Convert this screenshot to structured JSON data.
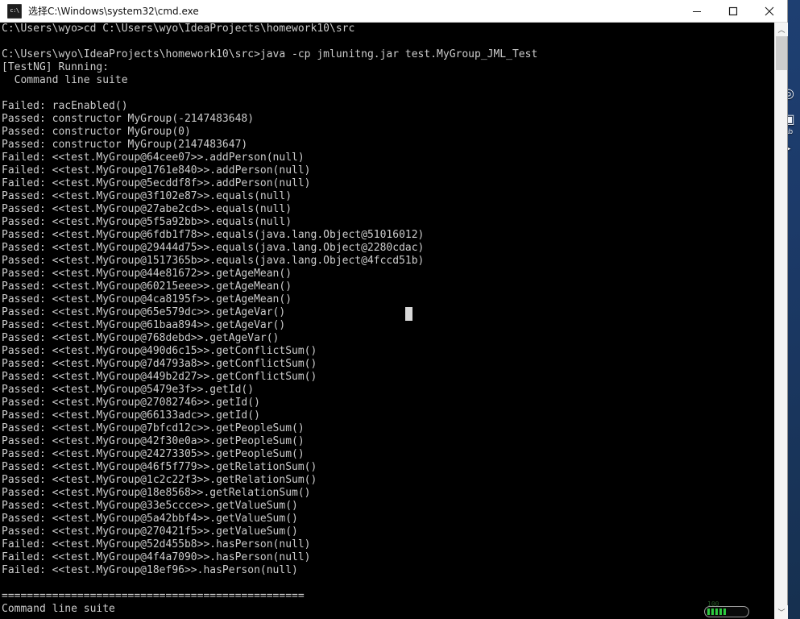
{
  "window": {
    "title": "选择C:\\Windows\\system32\\cmd.exe",
    "icon": "cmd-icon",
    "icon_glyph": "c:\\",
    "minimize_label": "Minimize",
    "maximize_label": "Maximize",
    "close_label": "Close"
  },
  "desktop": {
    "icons": [
      {
        "name": "desktop-icon-edge",
        "glyph": "◎",
        "label": ""
      },
      {
        "name": "desktop-icon-folder",
        "glyph": "▣",
        "label": "ab"
      },
      {
        "name": "desktop-icon-doc",
        "glyph": "▤",
        "label": ""
      }
    ],
    "cursor_glyph": "➤"
  },
  "scrollbar": {
    "up_arrow": "︿",
    "down_arrow": "﹀"
  },
  "tray": {
    "battery_label": "100",
    "battery_cells": 5
  },
  "console": {
    "prompt_1": "C:\\Users\\wyo>",
    "command_1": "cd C:\\Users\\wyo\\IdeaProjects\\homework10\\src",
    "prompt_2": "C:\\Users\\wyo\\IdeaProjects\\homework10\\src>",
    "command_2": "java -cp jmlunitng.jar test.MyGroup_JML_Test",
    "runner_header": "[TestNG] Running:",
    "suite_name": "  Command line suite",
    "separator": "================================================",
    "footer": "Command line suite",
    "results": [
      {
        "status": "Failed:",
        "target": "racEnabled()"
      },
      {
        "status": "Passed:",
        "target": "constructor MyGroup(-2147483648)"
      },
      {
        "status": "Passed:",
        "target": "constructor MyGroup(0)"
      },
      {
        "status": "Passed:",
        "target": "constructor MyGroup(2147483647)"
      },
      {
        "status": "Failed:",
        "target": "<<test.MyGroup@64cee07>>.addPerson(null)"
      },
      {
        "status": "Failed:",
        "target": "<<test.MyGroup@1761e840>>.addPerson(null)"
      },
      {
        "status": "Failed:",
        "target": "<<test.MyGroup@5ecddf8f>>.addPerson(null)"
      },
      {
        "status": "Passed:",
        "target": "<<test.MyGroup@3f102e87>>.equals(null)"
      },
      {
        "status": "Passed:",
        "target": "<<test.MyGroup@27abe2cd>>.equals(null)"
      },
      {
        "status": "Passed:",
        "target": "<<test.MyGroup@5f5a92bb>>.equals(null)"
      },
      {
        "status": "Passed:",
        "target": "<<test.MyGroup@6fdb1f78>>.equals(java.lang.Object@51016012)"
      },
      {
        "status": "Passed:",
        "target": "<<test.MyGroup@29444d75>>.equals(java.lang.Object@2280cdac)"
      },
      {
        "status": "Passed:",
        "target": "<<test.MyGroup@1517365b>>.equals(java.lang.Object@4fccd51b)"
      },
      {
        "status": "Passed:",
        "target": "<<test.MyGroup@44e81672>>.getAgeMean()"
      },
      {
        "status": "Passed:",
        "target": "<<test.MyGroup@60215eee>>.getAgeMean()"
      },
      {
        "status": "Passed:",
        "target": "<<test.MyGroup@4ca8195f>>.getAgeMean()"
      },
      {
        "status": "Passed:",
        "target": "<<test.MyGroup@65e579dc>>.getAgeVar()"
      },
      {
        "status": "Passed:",
        "target": "<<test.MyGroup@61baa894>>.getAgeVar()"
      },
      {
        "status": "Passed:",
        "target": "<<test.MyGroup@768debd>>.getAgeVar()"
      },
      {
        "status": "Passed:",
        "target": "<<test.MyGroup@490d6c15>>.getConflictSum()"
      },
      {
        "status": "Passed:",
        "target": "<<test.MyGroup@7d4793a8>>.getConflictSum()"
      },
      {
        "status": "Passed:",
        "target": "<<test.MyGroup@449b2d27>>.getConflictSum()"
      },
      {
        "status": "Passed:",
        "target": "<<test.MyGroup@5479e3f>>.getId()"
      },
      {
        "status": "Passed:",
        "target": "<<test.MyGroup@27082746>>.getId()"
      },
      {
        "status": "Passed:",
        "target": "<<test.MyGroup@66133adc>>.getId()"
      },
      {
        "status": "Passed:",
        "target": "<<test.MyGroup@7bfcd12c>>.getPeopleSum()"
      },
      {
        "status": "Passed:",
        "target": "<<test.MyGroup@42f30e0a>>.getPeopleSum()"
      },
      {
        "status": "Passed:",
        "target": "<<test.MyGroup@24273305>>.getPeopleSum()"
      },
      {
        "status": "Passed:",
        "target": "<<test.MyGroup@46f5f779>>.getRelationSum()"
      },
      {
        "status": "Passed:",
        "target": "<<test.MyGroup@1c2c22f3>>.getRelationSum()"
      },
      {
        "status": "Passed:",
        "target": "<<test.MyGroup@18e8568>>.getRelationSum()"
      },
      {
        "status": "Passed:",
        "target": "<<test.MyGroup@33e5ccce>>.getValueSum()"
      },
      {
        "status": "Passed:",
        "target": "<<test.MyGroup@5a42bbf4>>.getValueSum()"
      },
      {
        "status": "Passed:",
        "target": "<<test.MyGroup@270421f5>>.getValueSum()"
      },
      {
        "status": "Failed:",
        "target": "<<test.MyGroup@52d455b8>>.hasPerson(null)"
      },
      {
        "status": "Failed:",
        "target": "<<test.MyGroup@4f4a7090>>.hasPerson(null)"
      },
      {
        "status": "Failed:",
        "target": "<<test.MyGroup@18ef96>>.hasPerson(null)"
      }
    ]
  }
}
